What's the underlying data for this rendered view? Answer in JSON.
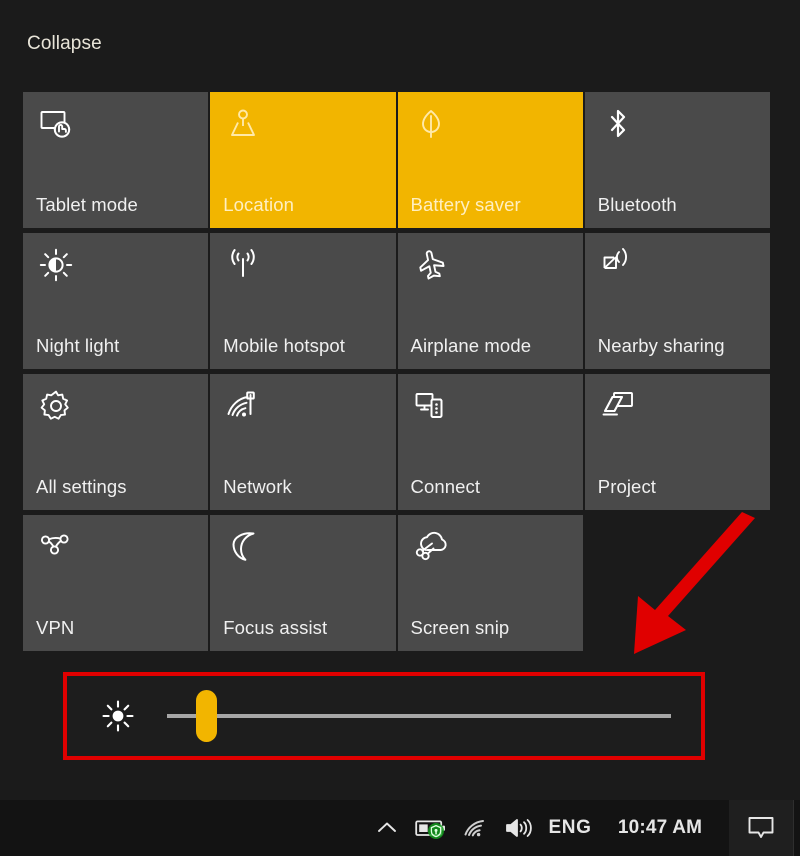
{
  "window": {
    "name": "Windows 10 Action Center",
    "background_color": "#1b1b1b",
    "collapse_label": "Collapse"
  },
  "accent_color": "#f2b500",
  "annotation": {
    "color": "#e00000",
    "arrow_name": "red-arrow-pointing-to-brightness-slider",
    "highlight_target": "brightness-slider-row"
  },
  "quick_actions": {
    "columns": 4,
    "tiles": [
      {
        "label": "Tablet mode",
        "icon": "tablet-mode-icon",
        "state": "off"
      },
      {
        "label": "Location",
        "icon": "location-icon",
        "state": "on"
      },
      {
        "label": "Battery saver",
        "icon": "battery-saver-icon",
        "state": "on"
      },
      {
        "label": "Bluetooth",
        "icon": "bluetooth-icon",
        "state": "off"
      },
      {
        "label": "Night light",
        "icon": "night-light-icon",
        "state": "off"
      },
      {
        "label": "Mobile hotspot",
        "icon": "mobile-hotspot-icon",
        "state": "off"
      },
      {
        "label": "Airplane mode",
        "icon": "airplane-mode-icon",
        "state": "off"
      },
      {
        "label": "Nearby sharing",
        "icon": "nearby-sharing-icon",
        "state": "off"
      },
      {
        "label": "All settings",
        "icon": "gear-icon",
        "state": "off"
      },
      {
        "label": "Network",
        "icon": "network-icon",
        "state": "off"
      },
      {
        "label": "Connect",
        "icon": "connect-icon",
        "state": "off"
      },
      {
        "label": "Project",
        "icon": "project-icon",
        "state": "off"
      },
      {
        "label": "VPN",
        "icon": "vpn-icon",
        "state": "off"
      },
      {
        "label": "Focus assist",
        "icon": "moon-icon",
        "state": "off"
      },
      {
        "label": "Screen snip",
        "icon": "screen-snip-icon",
        "state": "off"
      },
      {
        "label": "",
        "icon": "",
        "state": "empty"
      }
    ]
  },
  "brightness": {
    "icon": "brightness-icon",
    "value_percent": 6,
    "min": 0,
    "max": 100
  },
  "taskbar": {
    "chevron_icon": "chevron-up-icon",
    "battery_icon": "battery-with-security-shield-icon",
    "wifi_icon": "wifi-icon",
    "volume_icon": "speaker-volume-icon",
    "language": "ENG",
    "clock": "10:47 AM",
    "action_center_icon": "action-center-speech-bubble-icon"
  }
}
